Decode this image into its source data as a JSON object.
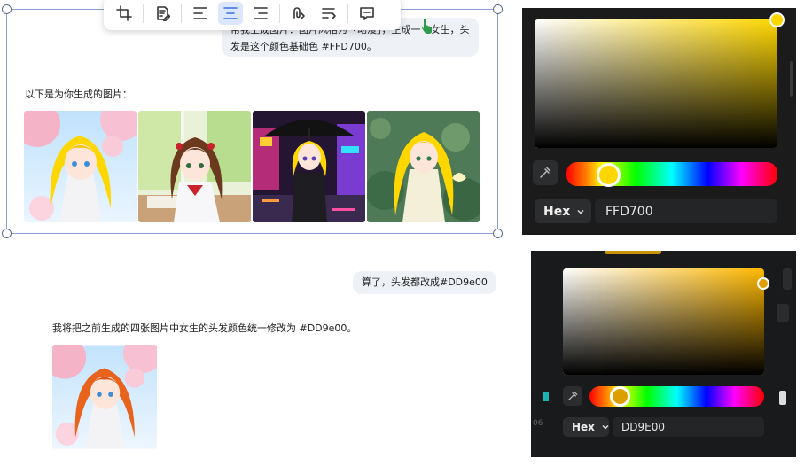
{
  "chat": {
    "user_message_1": "帮我生成图片：图片风格为「动漫」，生成一个女生，头发是这个颜色基础色 #FFD700。",
    "assistant_reply_1": "以下是为你生成的图片：",
    "user_message_2": "算了，头发都改成#DD9e00",
    "assistant_reply_2": "我将把之前生成的四张图片中女生的头发颜色统一修改为 #DD9e00。"
  },
  "toolbar": {
    "buttons": [
      "crop-icon",
      "edit-note-icon",
      "align-left-icon",
      "align-center-icon",
      "align-right-icon",
      "link-icon",
      "text-wrap-icon",
      "comment-icon"
    ],
    "active": "align-center-icon"
  },
  "images": [
    {
      "name": "anime-girl-cherry-blossom",
      "hair": "#FFD700"
    },
    {
      "name": "anime-girl-classroom",
      "hair": "#6b3a1e"
    },
    {
      "name": "anime-girl-umbrella-city",
      "hair": "#FFD700"
    },
    {
      "name": "anime-girl-lotus-pond",
      "hair": "#FFD700"
    },
    {
      "name": "anime-girl-cherry-blossom-orange",
      "hair": "#DD9E00"
    }
  ],
  "picker_1": {
    "base_color": "#FFD700",
    "hue_position": 0.14,
    "mode": "Hex",
    "hex_value": "FFD700"
  },
  "picker_2": {
    "base_color": "#DD9E00",
    "hue_position": 0.15,
    "mode": "Hex",
    "hex_value": "DD9E00",
    "ruler_label": "06"
  }
}
